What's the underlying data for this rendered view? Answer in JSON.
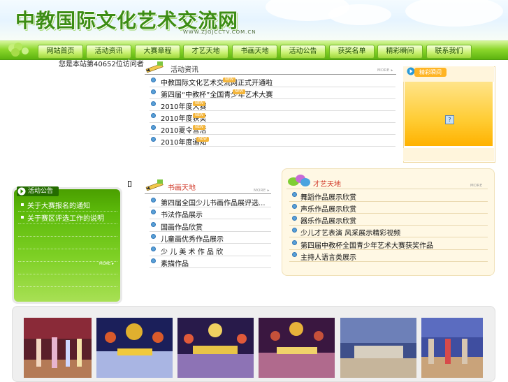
{
  "header": {
    "site_title": "中教国际文化艺术交流网",
    "site_url": "WWW.ZJGJCCTV.COM.CN"
  },
  "nav": {
    "items": [
      "网站首页",
      "活动资讯",
      "大赛章程",
      "才艺天地",
      "书画天地",
      "活动公告",
      "获奖名单",
      "精彩瞬间",
      "联系我们"
    ]
  },
  "visitor": {
    "text": "您是本站第40652位访问者"
  },
  "news": {
    "title": "活动资讯",
    "more_label": "MORE ▸",
    "new_badge": "NEW",
    "items": [
      "中教国际文化艺术交流网正式开通啦",
      "第四届“中教杯”全国青少年艺术大赛",
      "2010年度大赛",
      "2010年度获奖",
      "2010夏令营活",
      "2010年度通知"
    ]
  },
  "gallery_box": {
    "title": "精彩瞬间"
  },
  "notice": {
    "title": "活动公告",
    "more_label": "MORE ▸",
    "items": [
      "关于大赛报名的通知",
      "关于赛区评选工作的说明"
    ]
  },
  "painting": {
    "title": "书画天地",
    "more_label": "MORE ▸",
    "items": [
      "第四届全国少儿书画作品展评选...",
      "书法作品展示",
      "国画作品欣赏",
      "儿童画优秀作品展示",
      "少 儿 美 术 作 品 欣",
      "素描作品"
    ]
  },
  "talent": {
    "title": "才艺天地",
    "more_label": "MORE",
    "items": [
      "舞蹈作品展示欣赏",
      "声乐作品展示欣赏",
      "器乐作品展示欣赏",
      "少儿才艺表演 风采展示精彩视频",
      "第四届中教杯全国青少年艺术大赛获奖作品",
      "主持人语言类展示"
    ]
  },
  "photos": {
    "items": [
      "stage-photo-1",
      "stage-photo-2",
      "stage-photo-3",
      "stage-photo-4",
      "stage-photo-5",
      "stage-photo-6"
    ]
  },
  "colors": {
    "nav_green": "#5cb30f",
    "title_green": "#3c8d14",
    "notice_green": "#5cb90a",
    "accent_orange": "#f4b53a",
    "bullet_blue": "#5aa0d6"
  }
}
